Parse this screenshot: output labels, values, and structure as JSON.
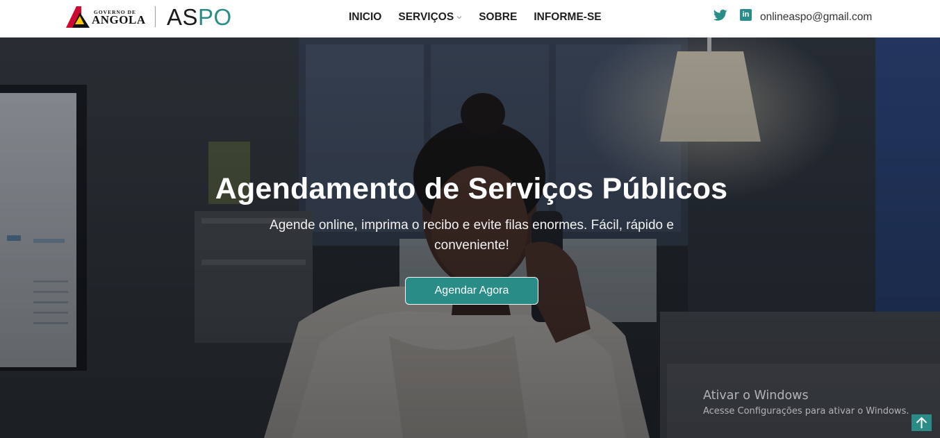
{
  "header": {
    "gov_logo": {
      "top_text": "GOVERNO DE",
      "main_text": "ANGOLA"
    },
    "brand": {
      "part1": "AS",
      "part2": "PO"
    },
    "nav": [
      {
        "label": "INICIO"
      },
      {
        "label": "SERVIÇOS"
      },
      {
        "label": "SOBRE"
      },
      {
        "label": "INFORME-SE"
      }
    ],
    "social": {
      "twitter_icon": "twitter-icon",
      "linkedin_icon": "linkedin-icon",
      "linkedin_text": "in"
    },
    "email": "onlineaspo@gmail.com"
  },
  "hero": {
    "title": "Agendamento de Serviços Públicos",
    "subtitle": "Agende online, imprima o recibo e evite filas enormes. Fácil, rápido e conveniente!",
    "cta_label": "Agendar Agora"
  },
  "windows_watermark": {
    "title": "Ativar o Windows",
    "subtitle": "Acesse Configurações para ativar o Windows."
  },
  "scroll_top": {
    "icon": "arrow-up-icon"
  },
  "colors": {
    "accent": "#2a8c87",
    "nav_text": "#1e1e1e",
    "flag_red": "#cc092f",
    "flag_yellow": "#ffcb00"
  }
}
